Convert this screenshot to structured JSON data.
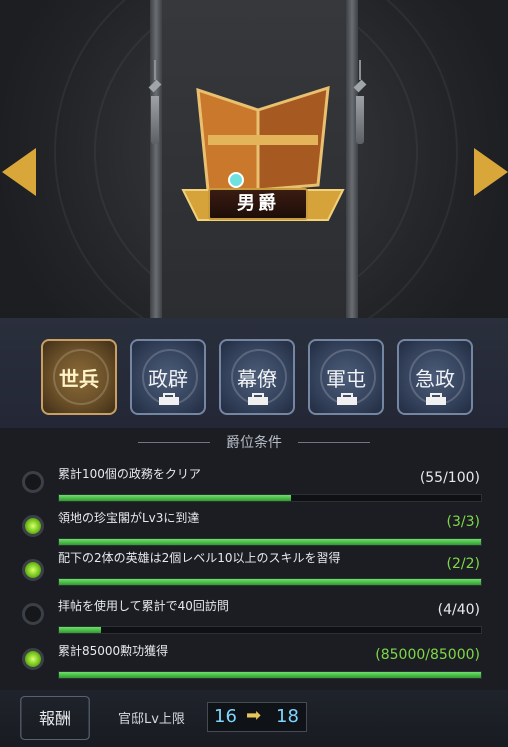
{
  "rank": {
    "title": "男爵"
  },
  "navigation": {
    "prev_icon": "left-arrow-icon",
    "next_icon": "right-arrow-icon"
  },
  "tabs": [
    {
      "label": "世兵",
      "state": "active",
      "locked": false
    },
    {
      "label": "政辟",
      "state": "locked",
      "locked": true
    },
    {
      "label": "幕僚",
      "state": "locked",
      "locked": true
    },
    {
      "label": "軍屯",
      "state": "locked",
      "locked": true
    },
    {
      "label": "急政",
      "state": "locked",
      "locked": true
    }
  ],
  "section": {
    "title": "爵位条件"
  },
  "conditions": [
    {
      "text": "累計100個の政務をクリア",
      "progress": "(55/100)",
      "fraction": 0.55,
      "done": false
    },
    {
      "text": "領地の珍宝閣がLv3に到達",
      "progress": "(3/3)",
      "fraction": 1.0,
      "done": true
    },
    {
      "text": "配下の2体の英雄は2個レベル10以上のスキルを習得",
      "progress": "(2/2)",
      "fraction": 1.0,
      "done": true
    },
    {
      "text": "拝帖を使用して累計で40回訪問",
      "progress": "(4/40)",
      "fraction": 0.1,
      "done": false
    },
    {
      "text": "累計85000勲功獲得",
      "progress": "(85000/85000)",
      "fraction": 1.0,
      "done": true
    }
  ],
  "reward": {
    "label": "報酬",
    "description": "官邸Lv上限",
    "from_level": "16",
    "to_level": "18"
  },
  "colors": {
    "gold": "#d9a63a",
    "progress_green": "#4fc84a",
    "done_text": "#7ed84a",
    "level_blue": "#7fd5ff"
  }
}
